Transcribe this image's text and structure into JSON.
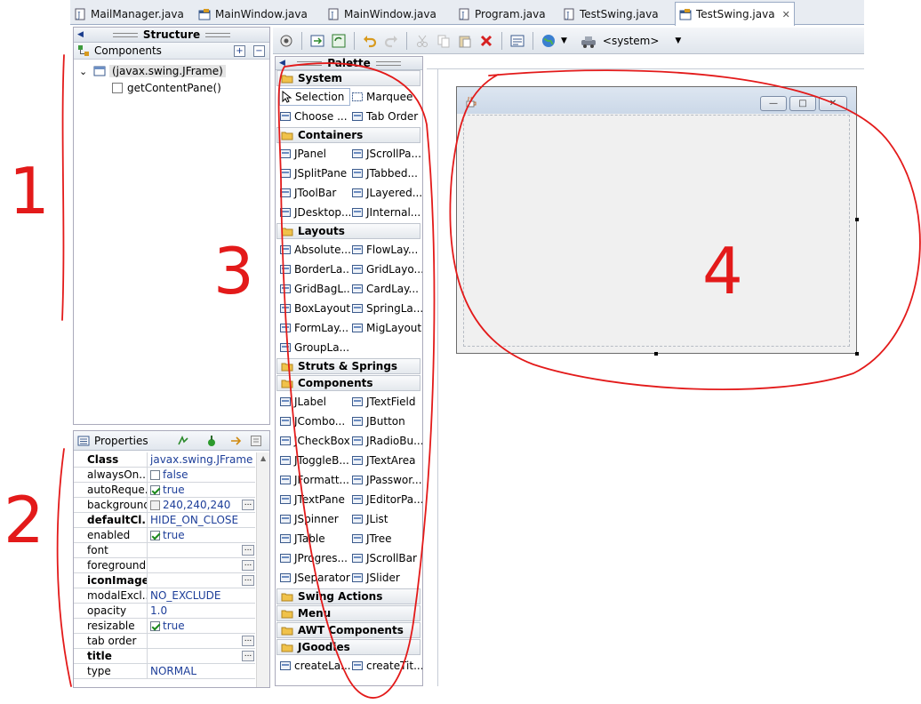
{
  "tabs": [
    {
      "label": "MailManager.java",
      "icon": "java-file-icon"
    },
    {
      "label": "MainWindow.java",
      "icon": "form-file-icon"
    },
    {
      "label": "MainWindow.java",
      "icon": "java-file-icon"
    },
    {
      "label": "Program.java",
      "icon": "java-file-icon"
    },
    {
      "label": "TestSwing.java",
      "icon": "java-file-icon"
    },
    {
      "label": "TestSwing.java",
      "icon": "form-file-icon",
      "active": true,
      "close": "✕"
    }
  ],
  "structure": {
    "title": "Structure",
    "components_label": "Components",
    "expand_btn": "+",
    "collapse_btn": "−",
    "tree": {
      "root": "(javax.swing.JFrame)",
      "child": "getContentPane()",
      "twisty": "⌄"
    }
  },
  "properties": {
    "title": "Properties",
    "rows": [
      {
        "name": "Class",
        "value": "javax.swing.JFrame",
        "bold": true
      },
      {
        "name": "alwaysOn...",
        "value": "false",
        "checkbox": false
      },
      {
        "name": "autoReque...",
        "value": "true",
        "checkbox": true
      },
      {
        "name": "background",
        "value": "240,240,240",
        "swatch": "#f0f0f0",
        "dots": true
      },
      {
        "name": "defaultCl...",
        "value": "HIDE_ON_CLOSE",
        "bold": true
      },
      {
        "name": "enabled",
        "value": "true",
        "checkbox": true
      },
      {
        "name": "font",
        "value": "",
        "dots": true
      },
      {
        "name": "foreground",
        "value": "",
        "dots": true
      },
      {
        "name": "iconImage",
        "value": "",
        "bold": true,
        "dots": true
      },
      {
        "name": "modalExcl...",
        "value": "NO_EXCLUDE"
      },
      {
        "name": "opacity",
        "value": "1.0"
      },
      {
        "name": "resizable",
        "value": "true",
        "checkbox": true
      },
      {
        "name": "tab order",
        "value": "",
        "dots": true
      },
      {
        "name": "title",
        "value": "",
        "bold": true,
        "dots": true
      },
      {
        "name": "type",
        "value": "NORMAL"
      }
    ],
    "dots_label": "..."
  },
  "toolbar": {
    "system_label": "<system>",
    "system_arrow": "▼",
    "locale_arrow": "▼"
  },
  "palette": {
    "title": "Palette",
    "sections": [
      {
        "name": "System",
        "items": [
          {
            "label": "Selection",
            "icon": "cursor-icon",
            "selected": true
          },
          {
            "label": "Marquee",
            "icon": "marquee-icon"
          },
          {
            "label": "Choose ...",
            "icon": "choose-bean-icon"
          },
          {
            "label": "Tab Order",
            "icon": "tab-order-icon"
          }
        ]
      },
      {
        "name": "Containers",
        "items": [
          {
            "label": "JPanel",
            "icon": "jpanel-icon"
          },
          {
            "label": "JScrollPa...",
            "icon": "jscrollpane-icon"
          },
          {
            "label": "JSplitPane",
            "icon": "jsplitpane-icon"
          },
          {
            "label": "JTabbed...",
            "icon": "jtabbedpane-icon"
          },
          {
            "label": "JToolBar",
            "icon": "jtoolbar-icon"
          },
          {
            "label": "JLayered...",
            "icon": "jlayeredpane-icon"
          },
          {
            "label": "JDesktop...",
            "icon": "jdesktoppane-icon"
          },
          {
            "label": "JInternal...",
            "icon": "jinternalframe-icon"
          }
        ]
      },
      {
        "name": "Layouts",
        "items": [
          {
            "label": "Absolute...",
            "icon": "absolute-layout-icon"
          },
          {
            "label": "FlowLay...",
            "icon": "flow-layout-icon"
          },
          {
            "label": "BorderLa...",
            "icon": "border-layout-icon"
          },
          {
            "label": "GridLayo...",
            "icon": "grid-layout-icon"
          },
          {
            "label": "GridBagL...",
            "icon": "gridbag-layout-icon"
          },
          {
            "label": "CardLay...",
            "icon": "card-layout-icon"
          },
          {
            "label": "BoxLayout",
            "icon": "box-layout-icon"
          },
          {
            "label": "SpringLa...",
            "icon": "spring-layout-icon"
          },
          {
            "label": "FormLay...",
            "icon": "form-layout-icon"
          },
          {
            "label": "MigLayout",
            "icon": "mig-layout-icon"
          },
          {
            "label": "GroupLa...",
            "icon": "group-layout-icon"
          }
        ]
      },
      {
        "name": "Struts & Springs",
        "items": []
      },
      {
        "name": "Components",
        "items": [
          {
            "label": "JLabel",
            "icon": "jlabel-icon"
          },
          {
            "label": "JTextField",
            "icon": "jtextfield-icon"
          },
          {
            "label": "JCombo...",
            "icon": "jcombobox-icon"
          },
          {
            "label": "JButton",
            "icon": "jbutton-icon"
          },
          {
            "label": "JCheckBox",
            "icon": "jcheckbox-icon"
          },
          {
            "label": "JRadioBu...",
            "icon": "jradiobutton-icon"
          },
          {
            "label": "JToggleB...",
            "icon": "jtogglebutton-icon"
          },
          {
            "label": "JTextArea",
            "icon": "jtextarea-icon"
          },
          {
            "label": "JFormatt...",
            "icon": "jformattedtext-icon"
          },
          {
            "label": "JPasswor...",
            "icon": "jpassword-icon"
          },
          {
            "label": "JTextPane",
            "icon": "jtextpane-icon"
          },
          {
            "label": "JEditorPa...",
            "icon": "jeditorpane-icon"
          },
          {
            "label": "JSpinner",
            "icon": "jspinner-icon"
          },
          {
            "label": "JList",
            "icon": "jlist-icon"
          },
          {
            "label": "JTable",
            "icon": "jtable-icon"
          },
          {
            "label": "JTree",
            "icon": "jtree-icon"
          },
          {
            "label": "JProgres...",
            "icon": "jprogressbar-icon"
          },
          {
            "label": "JScrollBar",
            "icon": "jscrollbar-icon"
          },
          {
            "label": "JSeparator",
            "icon": "jseparator-icon"
          },
          {
            "label": "JSlider",
            "icon": "jslider-icon"
          }
        ]
      },
      {
        "name": "Swing Actions",
        "items": []
      },
      {
        "name": "Menu",
        "items": []
      },
      {
        "name": "AWT Components",
        "items": []
      },
      {
        "name": "JGoodies",
        "items": [
          {
            "label": "createLa...",
            "icon": "jgoodies-label-icon"
          },
          {
            "label": "createTit...",
            "icon": "jgoodies-title-icon"
          }
        ]
      }
    ]
  },
  "frame": {
    "minimize": "—",
    "maximize": "□",
    "close": "✕"
  },
  "annotations": [
    "1",
    "2",
    "3",
    "4"
  ],
  "colors": {
    "annotation_red": "#e31a1a",
    "selection_blue": "#1d3e99"
  }
}
